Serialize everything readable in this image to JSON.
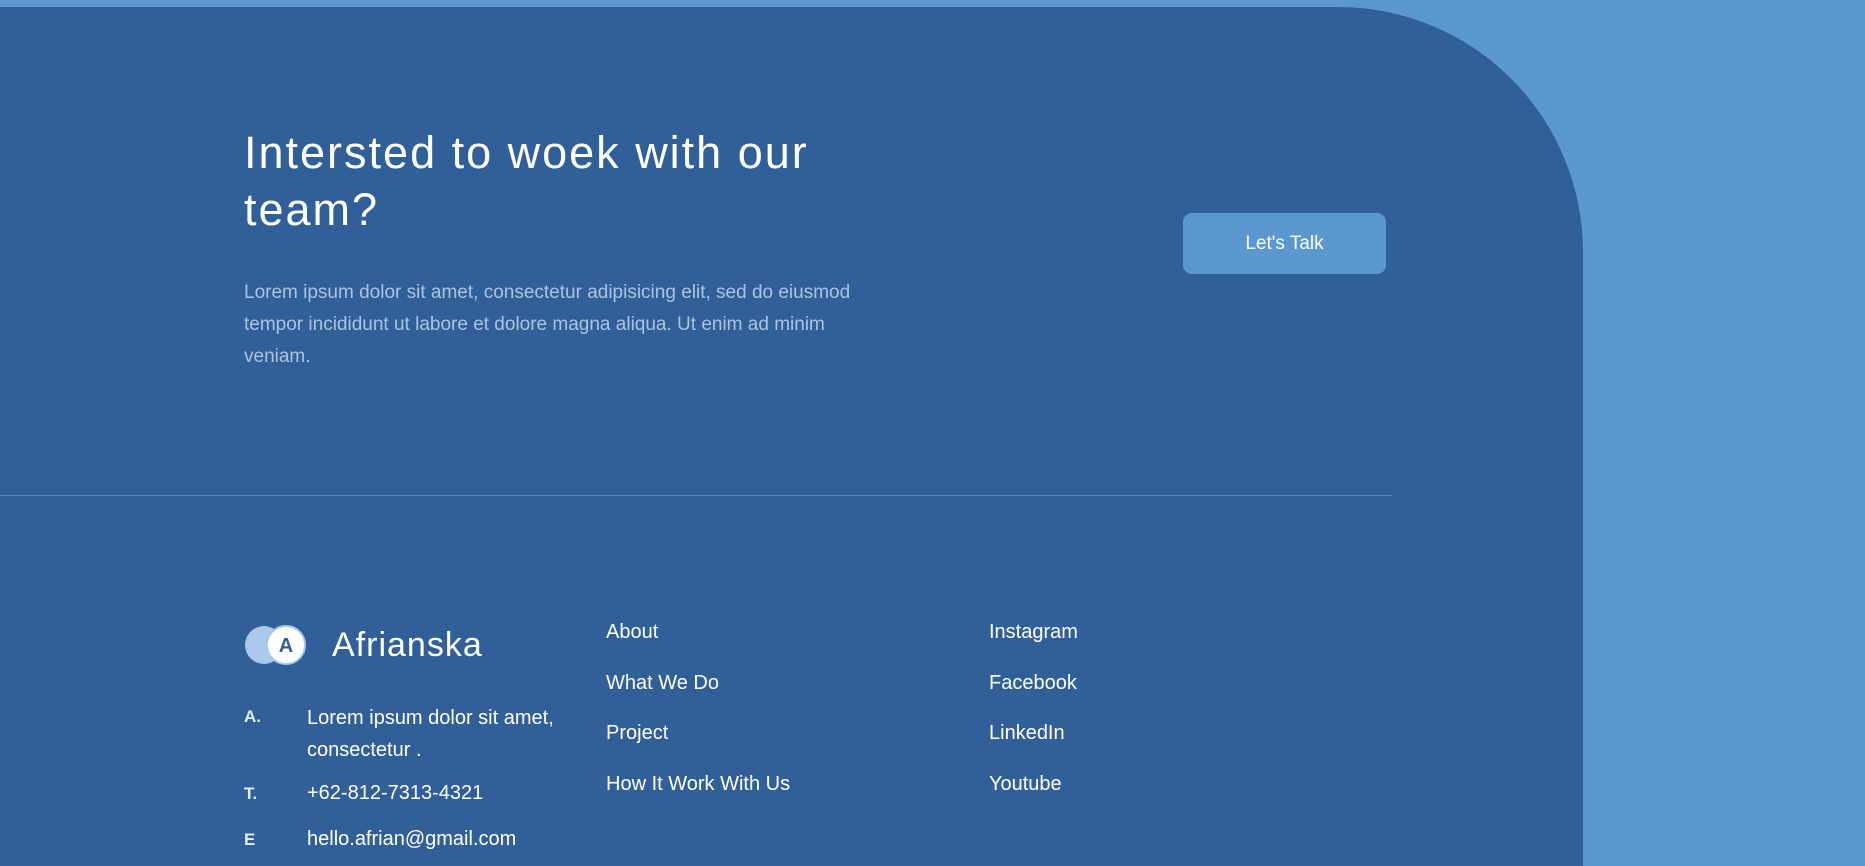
{
  "hero": {
    "title": "Intersted to woek with our team?",
    "text": "Lorem ipsum dolor sit amet, consectetur adipisicing elit, sed do eiusmod tempor incididunt ut labore et dolore magna aliqua. Ut enim ad minim veniam.",
    "cta_label": "Let's Talk"
  },
  "brand": {
    "logo_letter": "A",
    "name": "Afrianska"
  },
  "contact": {
    "address_key": "A.",
    "address": "Lorem ipsum dolor sit amet, consectetur .",
    "phone_key": "T.",
    "phone": "+62-812-7313-4321",
    "email_key": "E",
    "email": "hello.afrian@gmail.com"
  },
  "nav_links": [
    "About",
    "What We Do",
    "Project",
    "How It Work With Us"
  ],
  "social_links": [
    "Instagram",
    "Facebook",
    "LinkedIn",
    "Youtube"
  ],
  "colors": {
    "page_bg": "#5b98d0",
    "panel_bg": "#316098",
    "accent": "#5b98d0",
    "muted_text": "#aac3e2"
  }
}
